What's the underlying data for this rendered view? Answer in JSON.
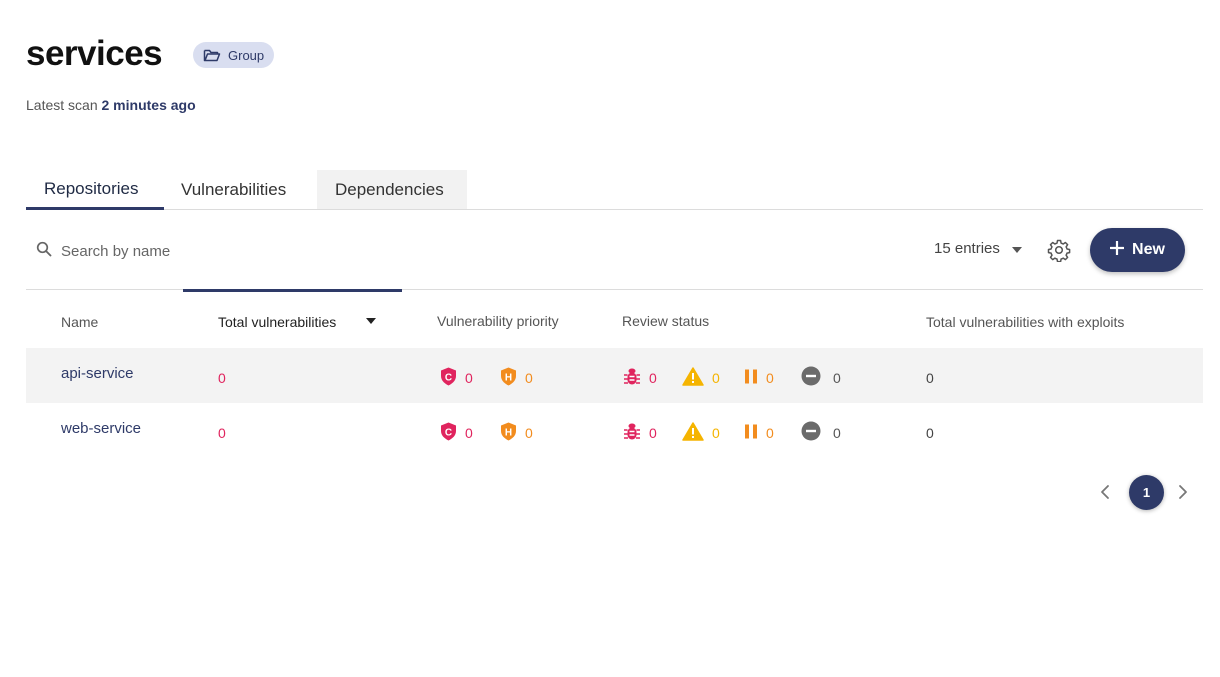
{
  "header": {
    "title": "services",
    "group_badge": "Group",
    "scan_prefix": "Latest scan",
    "scan_time": "2 minutes ago"
  },
  "tabs": [
    {
      "label": "Repositories",
      "active": true
    },
    {
      "label": "Vulnerabilities",
      "active": false
    },
    {
      "label": "Dependencies",
      "active": false
    }
  ],
  "toolbar": {
    "search_placeholder": "Search by name",
    "entries_label": "15 entries",
    "new_label": "New"
  },
  "table": {
    "columns": [
      "Name",
      "Total vulnerabilities",
      "Vulnerability priority",
      "Review status",
      "Total vulnerabilities with exploits"
    ],
    "sorted_column": "Total vulnerabilities",
    "rows": [
      {
        "name": "api-service",
        "total": "0",
        "priority_critical": "0",
        "priority_high": "0",
        "review_bug": "0",
        "review_warning": "0",
        "review_paused": "0",
        "review_ignored": "0",
        "exploits": "0"
      },
      {
        "name": "web-service",
        "total": "0",
        "priority_critical": "0",
        "priority_high": "0",
        "review_bug": "0",
        "review_warning": "0",
        "review_paused": "0",
        "review_ignored": "0",
        "exploits": "0"
      }
    ]
  },
  "pagination": {
    "current_page": "1"
  },
  "icons": {
    "critical": "shield-c-icon",
    "high": "shield-h-icon",
    "bug": "bug-icon",
    "warning": "warning-triangle-icon",
    "paused": "pause-icon",
    "ignored": "minus-circle-icon"
  },
  "colors": {
    "accent": "#2e3a68",
    "critical": "#e0245e",
    "high": "#f28c1e",
    "warning": "#f5b400",
    "neutral": "#6b6b6b"
  }
}
